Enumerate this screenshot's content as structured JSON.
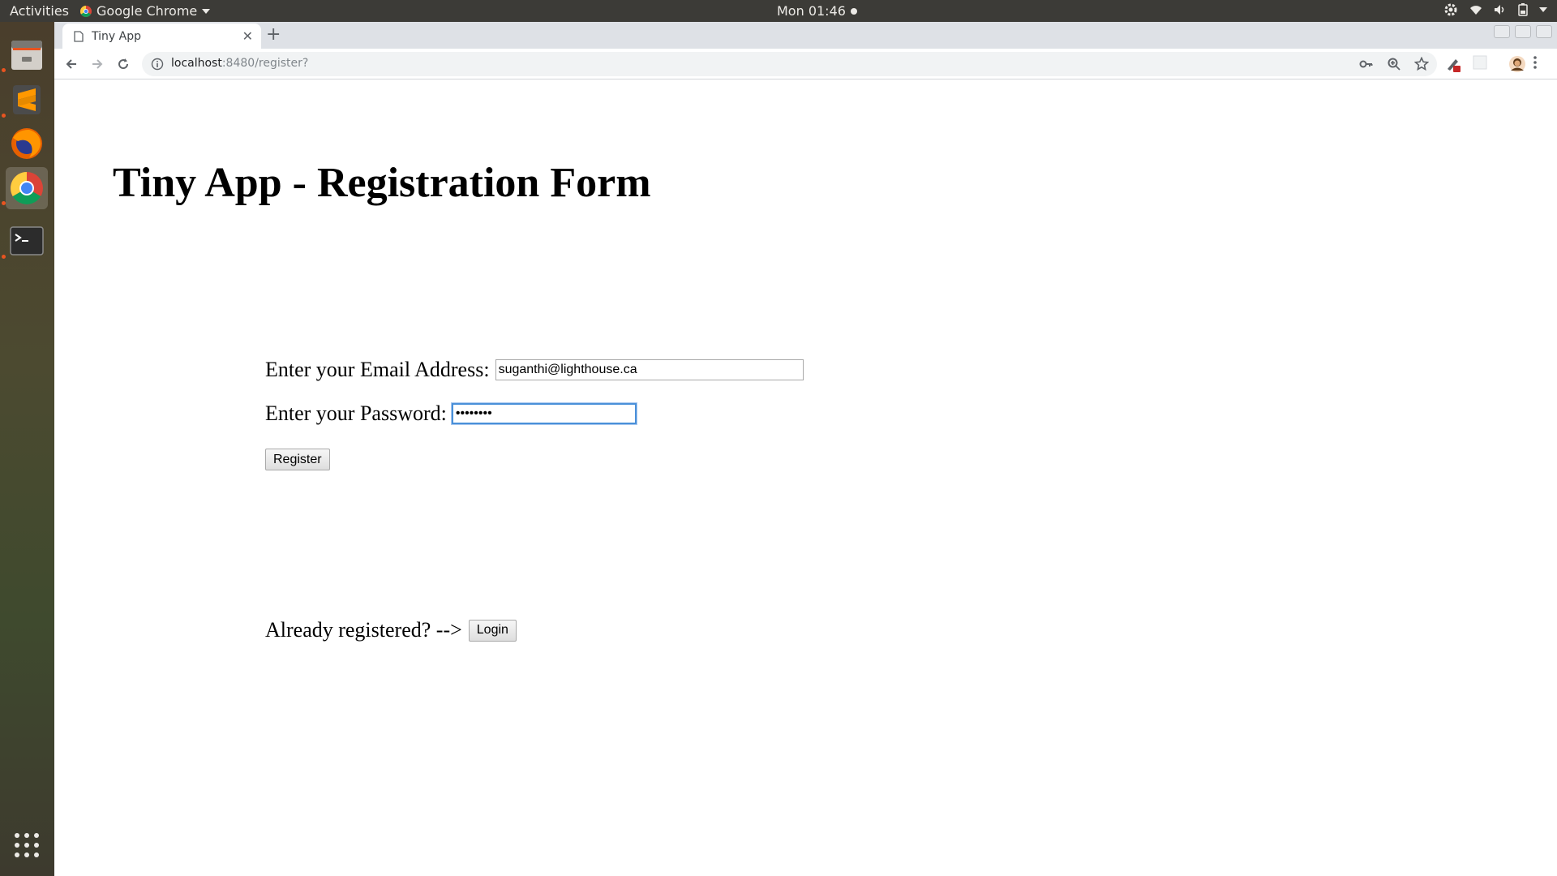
{
  "desktop": {
    "activities_label": "Activities",
    "app_menu_label": "Google Chrome",
    "clock": "Mon 01:46"
  },
  "dock": {
    "items": [
      {
        "name": "files"
      },
      {
        "name": "sublime-text"
      },
      {
        "name": "firefox"
      },
      {
        "name": "google-chrome"
      },
      {
        "name": "terminal"
      }
    ]
  },
  "browser": {
    "tab_title": "Tiny App",
    "url_host": "localhost",
    "url_path": ":8480/register?"
  },
  "page": {
    "title": "Tiny App - Registration Form",
    "email_label": "Enter your Email Address:",
    "email_value": "suganthi@lighthouse.ca",
    "password_label": "Enter your Password:",
    "password_value": "••••••••",
    "register_label": "Register",
    "already_text": "Already registered? -->",
    "login_label": "Login"
  }
}
